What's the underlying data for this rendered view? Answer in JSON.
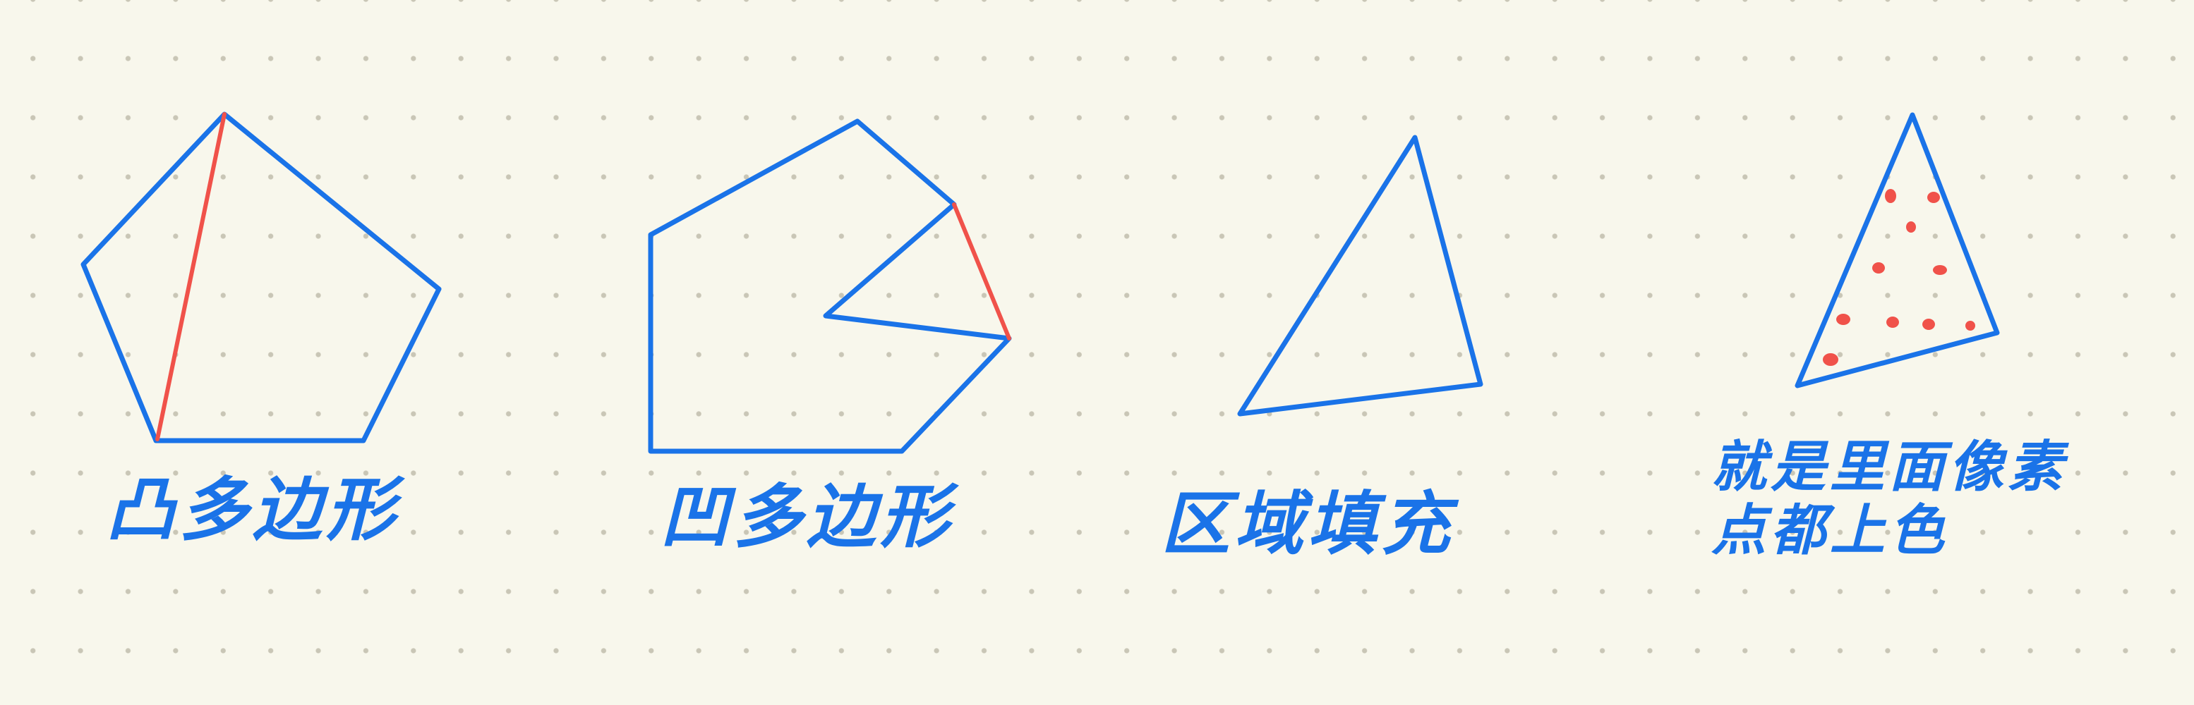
{
  "colors": {
    "background": "#f8f7ec",
    "dot_grid": "#c9c6b6",
    "ink_blue": "#1a73e8",
    "ink_red": "#f0524a"
  },
  "labels": {
    "convex_polygon": "凸多边形",
    "concave_polygon": "凹多边形",
    "region_fill": "区域填充",
    "explain_line1": "就是里面像素",
    "explain_line2": "点都上色"
  }
}
